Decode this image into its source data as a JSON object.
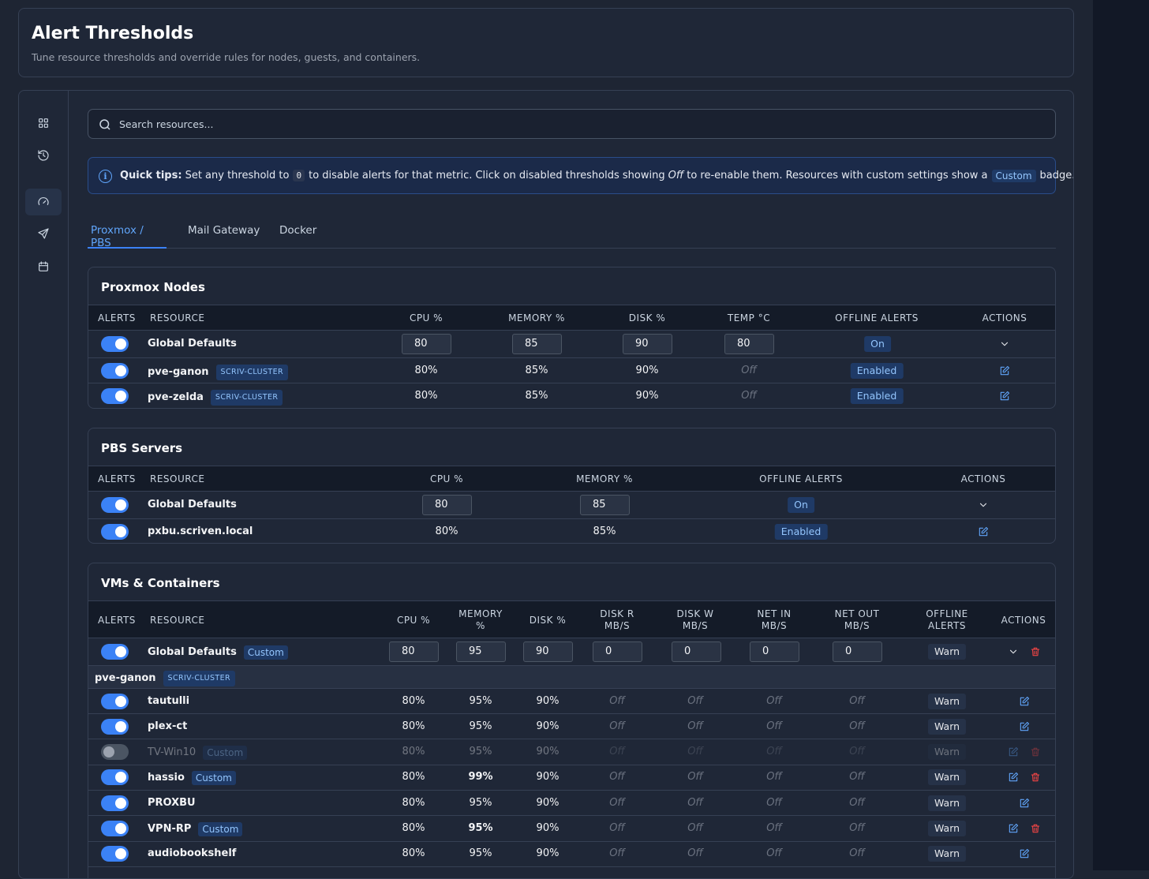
{
  "page": {
    "title": "Alert Thresholds",
    "subtitle": "Tune resource thresholds and override rules for nodes, guests, and containers."
  },
  "sidebar": {
    "icons": [
      "grid-icon",
      "history-icon",
      "gauge-icon",
      "send-icon",
      "calendar-icon"
    ],
    "active": "gauge-icon"
  },
  "search": {
    "placeholder": "Search resources..."
  },
  "tips": {
    "label": "Quick tips:",
    "part1": "Set any threshold to",
    "code": "0",
    "part2": "to disable alerts for that metric. Click on disabled thresholds showing",
    "off_word": "Off",
    "part3": "to re-enable them. Resources with custom settings show a",
    "badge": "Custom",
    "part4": "badge."
  },
  "tabs": [
    "Proxmox / PBS",
    "Mail Gateway",
    "Docker"
  ],
  "nodes": {
    "title": "Proxmox Nodes",
    "headers": [
      "ALERTS",
      "RESOURCE",
      "CPU %",
      "MEMORY %",
      "DISK %",
      "TEMP °C",
      "OFFLINE ALERTS",
      "ACTIONS"
    ],
    "defaults": {
      "name": "Global Defaults",
      "cpu": "80",
      "memory": "85",
      "disk": "90",
      "temp": "80",
      "offline": "On"
    },
    "rows": [
      {
        "name": "pve-ganon",
        "tag": "SCRIV-CLUSTER",
        "cpu": "80%",
        "memory": "85%",
        "disk": "90%",
        "temp": "Off",
        "offline": "Enabled"
      },
      {
        "name": "pve-zelda",
        "tag": "SCRIV-CLUSTER",
        "cpu": "80%",
        "memory": "85%",
        "disk": "90%",
        "temp": "Off",
        "offline": "Enabled"
      }
    ]
  },
  "pbs": {
    "title": "PBS Servers",
    "headers": [
      "ALERTS",
      "RESOURCE",
      "CPU %",
      "MEMORY %",
      "OFFLINE ALERTS",
      "ACTIONS"
    ],
    "defaults": {
      "name": "Global Defaults",
      "cpu": "80",
      "memory": "85",
      "offline": "On"
    },
    "rows": [
      {
        "name": "pxbu.scriven.local",
        "cpu": "80%",
        "memory": "85%",
        "offline": "Enabled"
      }
    ]
  },
  "vms": {
    "title": "VMs & Containers",
    "headers": {
      "alerts": "ALERTS",
      "resource": "RESOURCE",
      "cpu": "CPU %",
      "memory1": "MEMORY",
      "memory2": "%",
      "disk": "DISK %",
      "diskr1": "DISK R",
      "diskr2": "MB/S",
      "diskw1": "DISK W",
      "diskw2": "MB/S",
      "netin1": "NET IN",
      "netin2": "MB/S",
      "netout1": "NET OUT",
      "netout2": "MB/S",
      "offline1": "OFFLINE",
      "offline2": "ALERTS",
      "actions": "ACTIONS"
    },
    "defaults": {
      "name": "Global Defaults",
      "badge": "Custom",
      "cpu": "80",
      "memory": "95",
      "disk": "90",
      "diskr": "0",
      "diskw": "0",
      "netin": "0",
      "netout": "0",
      "offline": "Warn"
    },
    "group": {
      "name": "pve-ganon",
      "tag": "SCRIV-CLUSTER"
    },
    "rows": [
      {
        "name": "tautulli",
        "cpu": "80%",
        "memory": "95%",
        "disk": "90%",
        "diskr": "Off",
        "diskw": "Off",
        "netin": "Off",
        "netout": "Off",
        "offline": "Warn"
      },
      {
        "name": "plex-ct",
        "cpu": "80%",
        "memory": "95%",
        "disk": "90%",
        "diskr": "Off",
        "diskw": "Off",
        "netin": "Off",
        "netout": "Off",
        "offline": "Warn"
      },
      {
        "name": "TV-Win10",
        "badge": "Custom",
        "cpu": "80%",
        "memory": "95%",
        "disk": "90%",
        "diskr": "Off",
        "diskw": "Off",
        "netin": "Off",
        "netout": "Off",
        "offline": "Warn"
      },
      {
        "name": "hassio",
        "badge": "Custom",
        "cpu": "80%",
        "memory": "99%",
        "disk": "90%",
        "diskr": "Off",
        "diskw": "Off",
        "netin": "Off",
        "netout": "Off",
        "offline": "Warn"
      },
      {
        "name": "PROXBU",
        "cpu": "80%",
        "memory": "95%",
        "disk": "90%",
        "diskr": "Off",
        "diskw": "Off",
        "netin": "Off",
        "netout": "Off",
        "offline": "Warn"
      },
      {
        "name": "VPN-RP",
        "badge": "Custom",
        "cpu": "80%",
        "memory": "95%",
        "disk": "90%",
        "diskr": "Off",
        "diskw": "Off",
        "netin": "Off",
        "netout": "Off",
        "offline": "Warn"
      },
      {
        "name": "audiobookshelf",
        "cpu": "80%",
        "memory": "95%",
        "disk": "90%",
        "diskr": "Off",
        "diskw": "Off",
        "netin": "Off",
        "netout": "Off",
        "offline": "Warn"
      }
    ]
  },
  "colors": {
    "accent": "#3b82f6",
    "background": "#1e2533",
    "danger": "#ef4444"
  }
}
